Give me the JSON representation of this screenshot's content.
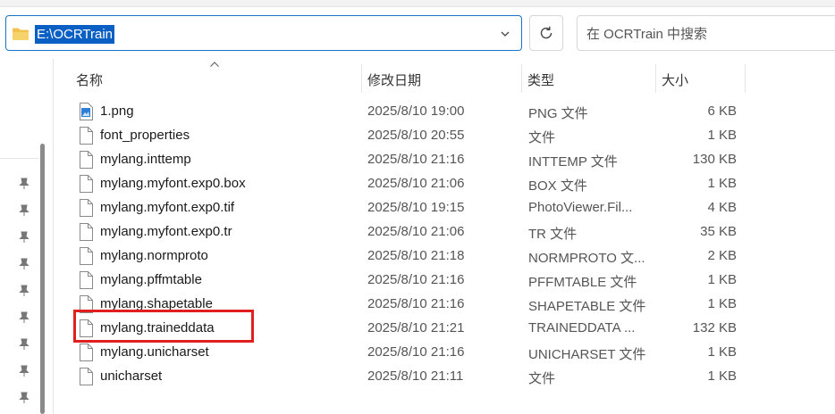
{
  "address": {
    "path": "E:\\OCRTrain"
  },
  "search": {
    "placeholder": "在 OCRTrain 中搜索"
  },
  "columns": {
    "name": "名称",
    "date": "修改日期",
    "type": "类型",
    "size": "大小"
  },
  "files": [
    {
      "name": "1.png",
      "date": "2025/8/10 19:00",
      "type": "PNG 文件",
      "size": "6 KB",
      "icon": "image-file-icon"
    },
    {
      "name": "font_properties",
      "date": "2025/8/10 20:55",
      "type": "文件",
      "size": "1 KB",
      "icon": "file-icon"
    },
    {
      "name": "mylang.inttemp",
      "date": "2025/8/10 21:16",
      "type": "INTTEMP 文件",
      "size": "130 KB",
      "icon": "file-icon"
    },
    {
      "name": "mylang.myfont.exp0.box",
      "date": "2025/8/10 21:06",
      "type": "BOX 文件",
      "size": "1 KB",
      "icon": "file-icon"
    },
    {
      "name": "mylang.myfont.exp0.tif",
      "date": "2025/8/10 19:15",
      "type": "PhotoViewer.Fil...",
      "size": "4 KB",
      "icon": "file-icon"
    },
    {
      "name": "mylang.myfont.exp0.tr",
      "date": "2025/8/10 21:06",
      "type": "TR 文件",
      "size": "35 KB",
      "icon": "file-icon"
    },
    {
      "name": "mylang.normproto",
      "date": "2025/8/10 21:18",
      "type": "NORMPROTO 文...",
      "size": "2 KB",
      "icon": "file-icon"
    },
    {
      "name": "mylang.pffmtable",
      "date": "2025/8/10 21:16",
      "type": "PFFMTABLE 文件",
      "size": "1 KB",
      "icon": "file-icon"
    },
    {
      "name": "mylang.shapetable",
      "date": "2025/8/10 21:16",
      "type": "SHAPETABLE 文件",
      "size": "1 KB",
      "icon": "file-icon"
    },
    {
      "name": "mylang.traineddata",
      "date": "2025/8/10 21:21",
      "type": "TRAINEDDATA ...",
      "size": "132 KB",
      "icon": "file-icon"
    },
    {
      "name": "mylang.unicharset",
      "date": "2025/8/10 21:16",
      "type": "UNICHARSET 文件",
      "size": "1 KB",
      "icon": "file-icon"
    },
    {
      "name": "unicharset",
      "date": "2025/8/10 21:11",
      "type": "文件",
      "size": "1 KB",
      "icon": "file-icon"
    }
  ],
  "colors": {
    "accent": "#0a5fc4",
    "highlight_box": "#e01f1f"
  }
}
